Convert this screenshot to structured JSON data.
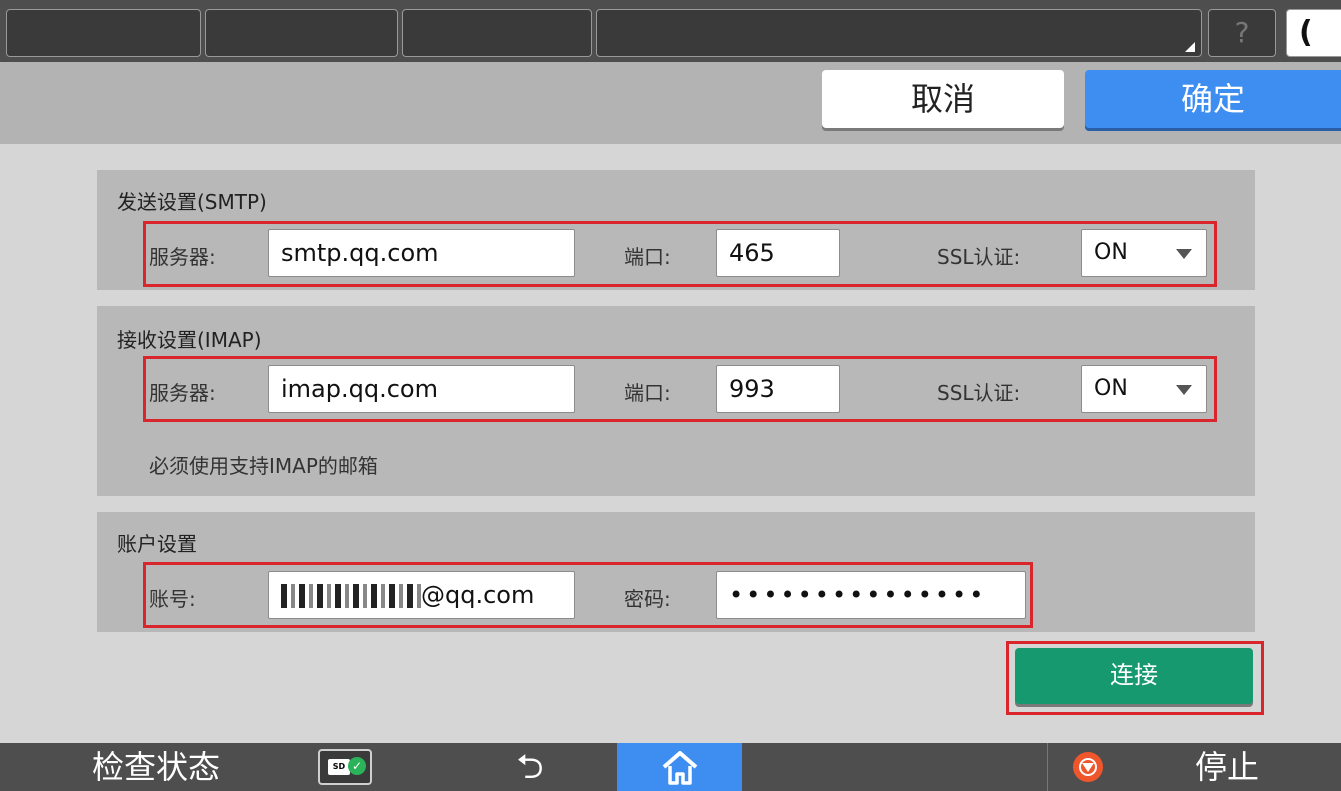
{
  "header": {
    "help_icon": "?",
    "moon_icon": "("
  },
  "actions": {
    "cancel": "取消",
    "ok": "确定"
  },
  "smtp": {
    "title": "发送设置(SMTP)",
    "server_label": "服务器:",
    "server_value": "smtp.qq.com",
    "port_label": "端口:",
    "port_value": "465",
    "ssl_label": "SSL认证:",
    "ssl_value": "ON"
  },
  "imap": {
    "title": "接收设置(IMAP)",
    "server_label": "服务器:",
    "server_value": "imap.qq.com",
    "port_label": "端口:",
    "port_value": "993",
    "ssl_label": "SSL认证:",
    "ssl_value": "ON",
    "note": "必须使用支持IMAP的邮箱"
  },
  "account": {
    "title": "账户设置",
    "account_label": "账号:",
    "account_suffix": "@qq.com",
    "password_label": "密码:",
    "password_value": "•••••••••••••••"
  },
  "connect": "连接",
  "footer": {
    "status": "检查状态",
    "sd_label": "SD",
    "back_icon": "⮌",
    "stop": "停止"
  },
  "colors": {
    "accent_blue": "#3d8ef0",
    "connect_green": "#17996f",
    "highlight_red": "#d9252c",
    "stop_orange": "#f0562b"
  }
}
